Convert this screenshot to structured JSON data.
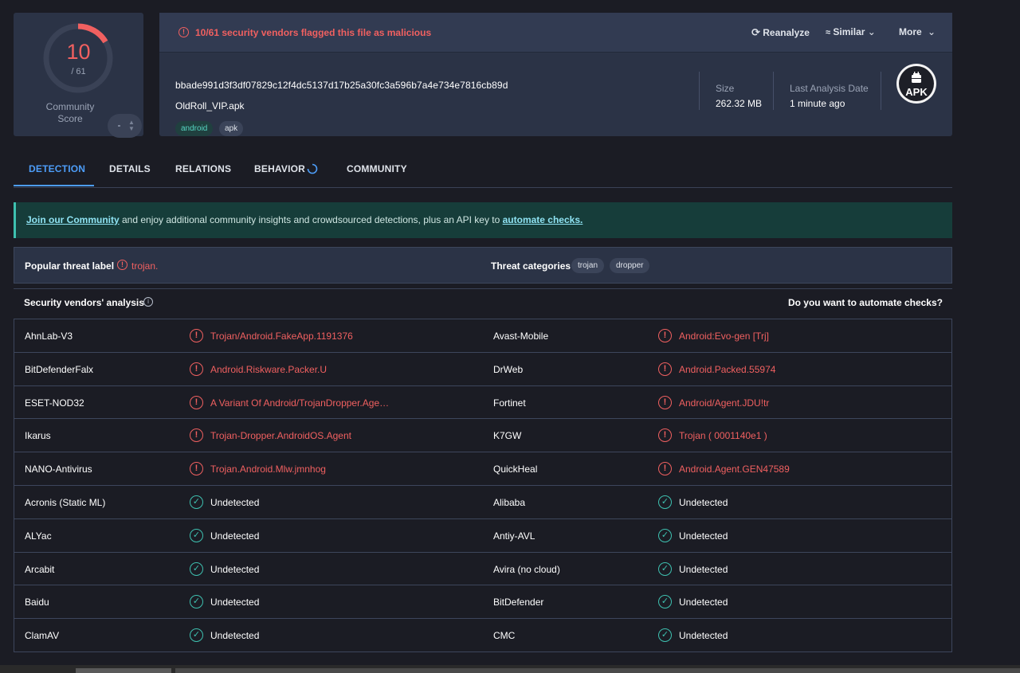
{
  "score": {
    "detected": "10",
    "total": "/ 61",
    "fraction": 0.164,
    "community_label": "Community Score"
  },
  "alert": {
    "text": "10/61 security vendors flagged this file as malicious"
  },
  "actions": {
    "reanalyze": "Reanalyze",
    "similar": "Similar",
    "more": "More"
  },
  "file": {
    "hash": "bbade991d3f3df07829c12f4dc5137d17b25a30fc3a596b7a4e734e7816cb89d",
    "name": "OldRoll_VIP.apk",
    "tags": [
      "android",
      "apk"
    ],
    "size_label": "Size",
    "size": "262.32 MB",
    "date_label": "Last Analysis Date",
    "date": "1 minute ago",
    "type_badge": "APK"
  },
  "tabs": [
    "DETECTION",
    "DETAILS",
    "RELATIONS",
    "BEHAVIOR",
    "COMMUNITY"
  ],
  "banner": {
    "link1": "Join our Community",
    "middle": " and enjoy additional community insights and crowdsourced detections, plus an API key to ",
    "link2": "automate checks."
  },
  "threat": {
    "popular_label": "Popular threat label",
    "popular_value": "trojan.",
    "categories_label": "Threat categories",
    "categories": [
      "trojan",
      "dropper"
    ]
  },
  "analysis": {
    "title": "Security vendors' analysis",
    "automate": "Do you want to automate checks?"
  },
  "rows": [
    {
      "v1": "AhnLab-V3",
      "r1": "Trojan/Android.FakeApp.1191376",
      "s1": "mal",
      "v2": "Avast-Mobile",
      "r2": "Android:Evo-gen [Trj]",
      "s2": "mal"
    },
    {
      "v1": "BitDefenderFalx",
      "r1": "Android.Riskware.Packer.U",
      "s1": "mal",
      "v2": "DrWeb",
      "r2": "Android.Packed.55974",
      "s2": "mal"
    },
    {
      "v1": "ESET-NOD32",
      "r1": "A Variant Of Android/TrojanDropper.Age…",
      "s1": "mal",
      "v2": "Fortinet",
      "r2": "Android/Agent.JDU!tr",
      "s2": "mal"
    },
    {
      "v1": "Ikarus",
      "r1": "Trojan-Dropper.AndroidOS.Agent",
      "s1": "mal",
      "v2": "K7GW",
      "r2": "Trojan ( 0001140e1 )",
      "s2": "mal"
    },
    {
      "v1": "NANO-Antivirus",
      "r1": "Trojan.Android.Mlw.jmnhog",
      "s1": "mal",
      "v2": "QuickHeal",
      "r2": "Android.Agent.GEN47589",
      "s2": "mal"
    },
    {
      "v1": "Acronis (Static ML)",
      "r1": "Undetected",
      "s1": "ok",
      "v2": "Alibaba",
      "r2": "Undetected",
      "s2": "ok"
    },
    {
      "v1": "ALYac",
      "r1": "Undetected",
      "s1": "ok",
      "v2": "Antiy-AVL",
      "r2": "Undetected",
      "s2": "ok"
    },
    {
      "v1": "Arcabit",
      "r1": "Undetected",
      "s1": "ok",
      "v2": "Avira (no cloud)",
      "r2": "Undetected",
      "s2": "ok"
    },
    {
      "v1": "Baidu",
      "r1": "Undetected",
      "s1": "ok",
      "v2": "BitDefender",
      "r2": "Undetected",
      "s2": "ok"
    },
    {
      "v1": "ClamAV",
      "r1": "Undetected",
      "s1": "ok",
      "v2": "CMC",
      "r2": "Undetected",
      "s2": "ok"
    }
  ],
  "colors": {
    "malicious": "#f06060",
    "clean": "#3ec1b0",
    "accent": "#4d9df8"
  }
}
